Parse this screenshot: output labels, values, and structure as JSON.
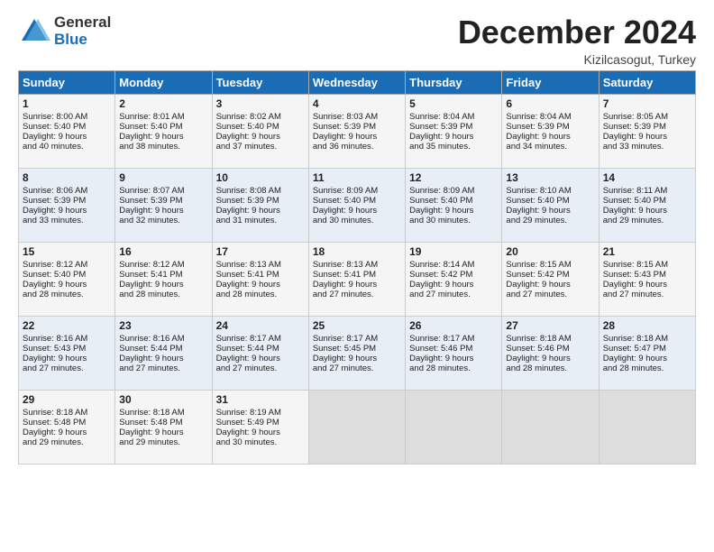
{
  "logo": {
    "general": "General",
    "blue": "Blue"
  },
  "header": {
    "month": "December 2024",
    "location": "Kizilcasogut, Turkey"
  },
  "weekdays": [
    "Sunday",
    "Monday",
    "Tuesday",
    "Wednesday",
    "Thursday",
    "Friday",
    "Saturday"
  ],
  "weeks": [
    [
      {
        "day": "1",
        "lines": [
          "Sunrise: 8:00 AM",
          "Sunset: 5:40 PM",
          "Daylight: 9 hours",
          "and 40 minutes."
        ]
      },
      {
        "day": "2",
        "lines": [
          "Sunrise: 8:01 AM",
          "Sunset: 5:40 PM",
          "Daylight: 9 hours",
          "and 38 minutes."
        ]
      },
      {
        "day": "3",
        "lines": [
          "Sunrise: 8:02 AM",
          "Sunset: 5:40 PM",
          "Daylight: 9 hours",
          "and 37 minutes."
        ]
      },
      {
        "day": "4",
        "lines": [
          "Sunrise: 8:03 AM",
          "Sunset: 5:39 PM",
          "Daylight: 9 hours",
          "and 36 minutes."
        ]
      },
      {
        "day": "5",
        "lines": [
          "Sunrise: 8:04 AM",
          "Sunset: 5:39 PM",
          "Daylight: 9 hours",
          "and 35 minutes."
        ]
      },
      {
        "day": "6",
        "lines": [
          "Sunrise: 8:04 AM",
          "Sunset: 5:39 PM",
          "Daylight: 9 hours",
          "and 34 minutes."
        ]
      },
      {
        "day": "7",
        "lines": [
          "Sunrise: 8:05 AM",
          "Sunset: 5:39 PM",
          "Daylight: 9 hours",
          "and 33 minutes."
        ]
      }
    ],
    [
      {
        "day": "8",
        "lines": [
          "Sunrise: 8:06 AM",
          "Sunset: 5:39 PM",
          "Daylight: 9 hours",
          "and 33 minutes."
        ]
      },
      {
        "day": "9",
        "lines": [
          "Sunrise: 8:07 AM",
          "Sunset: 5:39 PM",
          "Daylight: 9 hours",
          "and 32 minutes."
        ]
      },
      {
        "day": "10",
        "lines": [
          "Sunrise: 8:08 AM",
          "Sunset: 5:39 PM",
          "Daylight: 9 hours",
          "and 31 minutes."
        ]
      },
      {
        "day": "11",
        "lines": [
          "Sunrise: 8:09 AM",
          "Sunset: 5:40 PM",
          "Daylight: 9 hours",
          "and 30 minutes."
        ]
      },
      {
        "day": "12",
        "lines": [
          "Sunrise: 8:09 AM",
          "Sunset: 5:40 PM",
          "Daylight: 9 hours",
          "and 30 minutes."
        ]
      },
      {
        "day": "13",
        "lines": [
          "Sunrise: 8:10 AM",
          "Sunset: 5:40 PM",
          "Daylight: 9 hours",
          "and 29 minutes."
        ]
      },
      {
        "day": "14",
        "lines": [
          "Sunrise: 8:11 AM",
          "Sunset: 5:40 PM",
          "Daylight: 9 hours",
          "and 29 minutes."
        ]
      }
    ],
    [
      {
        "day": "15",
        "lines": [
          "Sunrise: 8:12 AM",
          "Sunset: 5:40 PM",
          "Daylight: 9 hours",
          "and 28 minutes."
        ]
      },
      {
        "day": "16",
        "lines": [
          "Sunrise: 8:12 AM",
          "Sunset: 5:41 PM",
          "Daylight: 9 hours",
          "and 28 minutes."
        ]
      },
      {
        "day": "17",
        "lines": [
          "Sunrise: 8:13 AM",
          "Sunset: 5:41 PM",
          "Daylight: 9 hours",
          "and 28 minutes."
        ]
      },
      {
        "day": "18",
        "lines": [
          "Sunrise: 8:13 AM",
          "Sunset: 5:41 PM",
          "Daylight: 9 hours",
          "and 27 minutes."
        ]
      },
      {
        "day": "19",
        "lines": [
          "Sunrise: 8:14 AM",
          "Sunset: 5:42 PM",
          "Daylight: 9 hours",
          "and 27 minutes."
        ]
      },
      {
        "day": "20",
        "lines": [
          "Sunrise: 8:15 AM",
          "Sunset: 5:42 PM",
          "Daylight: 9 hours",
          "and 27 minutes."
        ]
      },
      {
        "day": "21",
        "lines": [
          "Sunrise: 8:15 AM",
          "Sunset: 5:43 PM",
          "Daylight: 9 hours",
          "and 27 minutes."
        ]
      }
    ],
    [
      {
        "day": "22",
        "lines": [
          "Sunrise: 8:16 AM",
          "Sunset: 5:43 PM",
          "Daylight: 9 hours",
          "and 27 minutes."
        ]
      },
      {
        "day": "23",
        "lines": [
          "Sunrise: 8:16 AM",
          "Sunset: 5:44 PM",
          "Daylight: 9 hours",
          "and 27 minutes."
        ]
      },
      {
        "day": "24",
        "lines": [
          "Sunrise: 8:17 AM",
          "Sunset: 5:44 PM",
          "Daylight: 9 hours",
          "and 27 minutes."
        ]
      },
      {
        "day": "25",
        "lines": [
          "Sunrise: 8:17 AM",
          "Sunset: 5:45 PM",
          "Daylight: 9 hours",
          "and 27 minutes."
        ]
      },
      {
        "day": "26",
        "lines": [
          "Sunrise: 8:17 AM",
          "Sunset: 5:46 PM",
          "Daylight: 9 hours",
          "and 28 minutes."
        ]
      },
      {
        "day": "27",
        "lines": [
          "Sunrise: 8:18 AM",
          "Sunset: 5:46 PM",
          "Daylight: 9 hours",
          "and 28 minutes."
        ]
      },
      {
        "day": "28",
        "lines": [
          "Sunrise: 8:18 AM",
          "Sunset: 5:47 PM",
          "Daylight: 9 hours",
          "and 28 minutes."
        ]
      }
    ],
    [
      {
        "day": "29",
        "lines": [
          "Sunrise: 8:18 AM",
          "Sunset: 5:48 PM",
          "Daylight: 9 hours",
          "and 29 minutes."
        ]
      },
      {
        "day": "30",
        "lines": [
          "Sunrise: 8:18 AM",
          "Sunset: 5:48 PM",
          "Daylight: 9 hours",
          "and 29 minutes."
        ]
      },
      {
        "day": "31",
        "lines": [
          "Sunrise: 8:19 AM",
          "Sunset: 5:49 PM",
          "Daylight: 9 hours",
          "and 30 minutes."
        ]
      },
      null,
      null,
      null,
      null
    ]
  ]
}
